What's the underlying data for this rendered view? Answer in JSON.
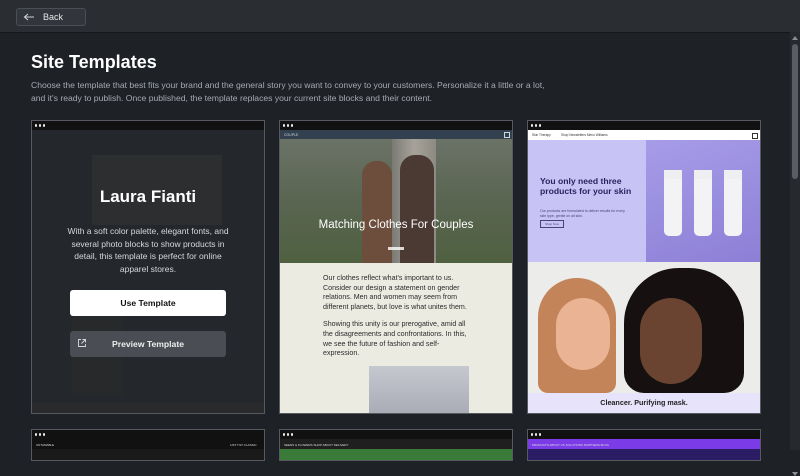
{
  "topbar": {
    "back_label": "Back"
  },
  "page": {
    "title": "Site Templates",
    "description": "Choose the template that best fits your brand and the general story you want to convey to your customers. Personalize it a little or a lot, and it's ready to publish. Once published, the template replaces your current site blocks and their content."
  },
  "templates": [
    {
      "name": "Laura Fianti",
      "blurb": "With a soft color palette, elegant fonts, and several photo blocks to show products in detail, this template is perfect for online apparel stores.",
      "use_label": "Use Template",
      "preview_label": "Preview Template"
    },
    {
      "nav_logo": "COUPLE",
      "hero_title": "Matching Clothes For Couples",
      "para1": "Our clothes reflect what's important to us. Consider our design a statement on gender relations.  Men and women may seem from different planets, but love is what unites them.",
      "para2": "Showing this unity is our prerogative, amid all the disagreements and confrontations. In this, we see the future of fashion and self-expression."
    },
    {
      "nav_brand": "Skin Therapy",
      "nav_links": "Shop   Newsletters   Menu   Williams",
      "headline": "You only need three products for your skin",
      "sub": "Our products are formulated to deliver results for every skin type, gentle on all skin.",
      "shop_label": "Shop Now",
      "caption": "Cleancer. Purifying mask."
    }
  ],
  "row2": [
    {
      "nav_left": "UNTAMABLE",
      "nav_right": "LIST TILT  CLASSIC"
    },
    {
      "nav_left": "SEEDS & FLOWERS   SHOP   ABOUT   DELIVERY"
    },
    {
      "nav_left": "PRODUCTS   ABOUT US   SOLUTIONS PARTNERS   BLOG"
    }
  ]
}
